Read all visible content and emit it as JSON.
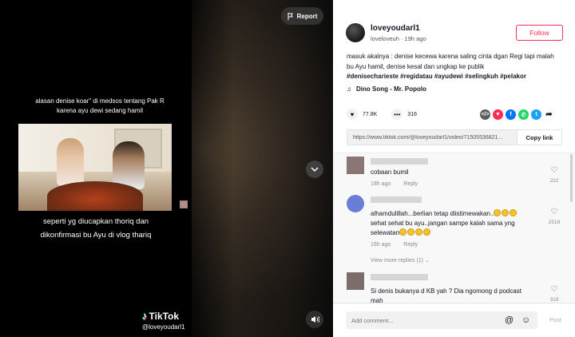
{
  "video": {
    "caption_top": "alasan denise koar\" di medsos tentang Pak R karena ayu dewi sedang hamil",
    "caption_bottom": "seperti yg diucapkan thoriq dan dikonfirmasi bu Ayu di vlog thariq",
    "watermark_logo": "TikTok",
    "watermark_handle": "@loveyoudarl1",
    "report_label": "Report"
  },
  "post": {
    "username": "loveyoudarl1",
    "subline": "loveloveuh · 19h ago",
    "follow_label": "Follow",
    "description": "masuk akalnya : denise kecewa karena saling cinta dgan Regi tapi malah bu Ayu hamil, denise kesal dan ungkap ke publik",
    "hashtags": "#denisecharieste #regidatau #ayudewi #selingkuh #pelakor",
    "music": "Dino Song - Mr. Popolo",
    "likes": "77.8K",
    "comments_count": "316",
    "link": "https://www.tiktok.com/@loveyoudarl1/video/71505536821...",
    "copy_label": "Copy link"
  },
  "comments": [
    {
      "text": "cobaan bumil",
      "time": "18h ago",
      "reply": "Reply",
      "likes": "222"
    },
    {
      "text": "alhamdulillah...berlian tetap diistimewakan..",
      "text2": "sehat sehat bu ayu..jangan sampe kalah sama yng",
      "text3": "selewatan",
      "time": "16h ago",
      "reply": "Reply",
      "likes": "2518",
      "view_more": "View more replies (1)"
    },
    {
      "text": "Si denis bukanya d KB yah ? Dia ngomong d podcast",
      "text2": "mah",
      "likes": "319"
    }
  ],
  "comment_bar": {
    "placeholder": "Add comment...",
    "post_label": "Post"
  },
  "colors": {
    "brand": "#fe2c55",
    "text": "#161823",
    "muted": "#8a8b91"
  }
}
